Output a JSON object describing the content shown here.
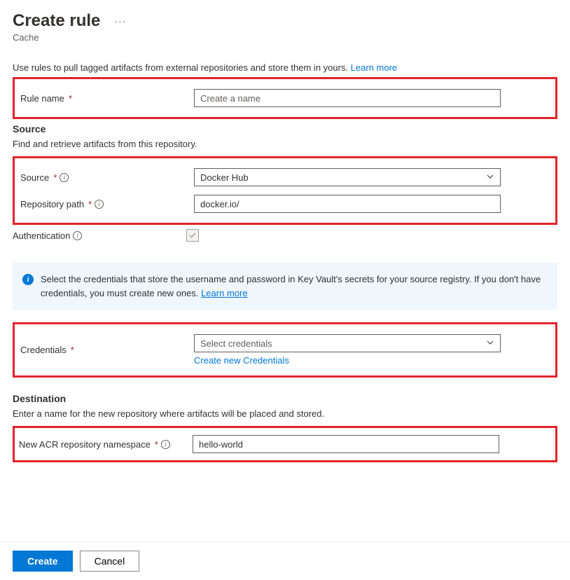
{
  "header": {
    "title": "Create rule",
    "subtitle": "Cache"
  },
  "description": {
    "text": "Use rules to pull tagged artifacts from external repositories and store them in yours.",
    "link": "Learn more"
  },
  "ruleName": {
    "label": "Rule name",
    "placeholder": "Create a name",
    "value": ""
  },
  "source": {
    "title": "Source",
    "desc": "Find and retrieve artifacts from this repository.",
    "sourceLabel": "Source",
    "sourceValue": "Docker Hub",
    "repoLabel": "Repository path",
    "repoValue": "docker.io/",
    "authLabel": "Authentication"
  },
  "banner": {
    "text": "Select the credentials that store the username and password in Key Vault's secrets for your source registry. If you don't have credentials, you must create new ones.",
    "link": "Learn more"
  },
  "credentials": {
    "label": "Credentials",
    "placeholder": "Select credentials",
    "createLink": "Create new Credentials"
  },
  "destination": {
    "title": "Destination",
    "desc": "Enter a name for the new repository where artifacts will be placed and stored.",
    "label": "New ACR repository namespace",
    "value": "hello-world"
  },
  "footer": {
    "create": "Create",
    "cancel": "Cancel"
  }
}
